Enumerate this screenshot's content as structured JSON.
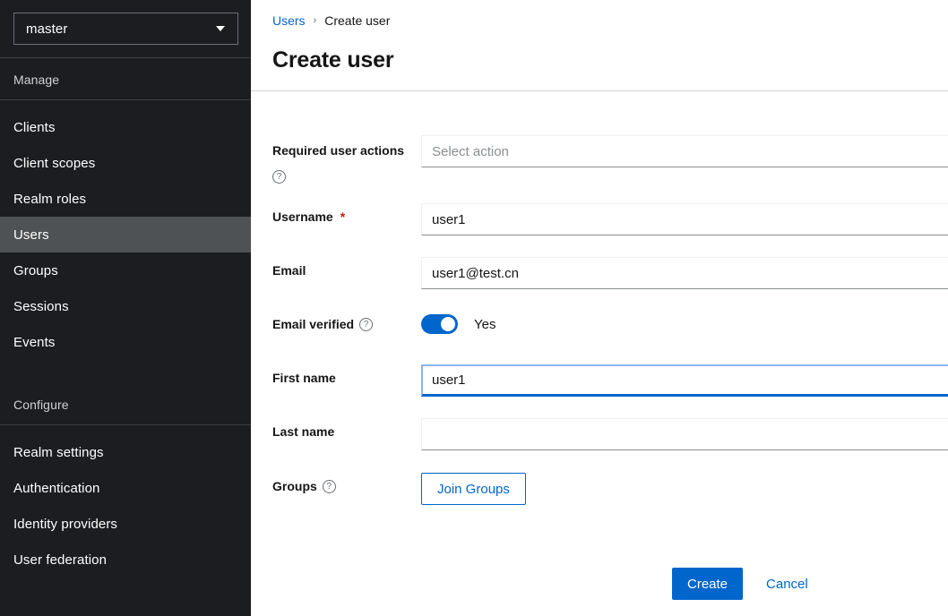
{
  "sidebar": {
    "realm_selector": {
      "value": "master",
      "icon": "chevron-down-icon"
    },
    "sections": [
      {
        "title": "Manage",
        "items": [
          {
            "label": "Clients",
            "selected": false
          },
          {
            "label": "Client scopes",
            "selected": false
          },
          {
            "label": "Realm roles",
            "selected": false
          },
          {
            "label": "Users",
            "selected": true
          },
          {
            "label": "Groups",
            "selected": false
          },
          {
            "label": "Sessions",
            "selected": false
          },
          {
            "label": "Events",
            "selected": false
          }
        ]
      },
      {
        "title": "Configure",
        "items": [
          {
            "label": "Realm settings",
            "selected": false
          },
          {
            "label": "Authentication",
            "selected": false
          },
          {
            "label": "Identity providers",
            "selected": false
          },
          {
            "label": "User federation",
            "selected": false
          }
        ]
      }
    ]
  },
  "header": {
    "breadcrumb": {
      "parent": "Users",
      "separator": "›",
      "current": "Create user"
    },
    "title": "Create user"
  },
  "form": {
    "required_user_actions": {
      "label": "Required user actions",
      "help_icon": "question-circle-icon",
      "placeholder": "Select action",
      "value": ""
    },
    "username": {
      "label": "Username",
      "required_marker": "*",
      "value": "user1",
      "placeholder": ""
    },
    "email": {
      "label": "Email",
      "value": "user1@test.cn",
      "placeholder": ""
    },
    "email_verified": {
      "label": "Email verified",
      "help_icon": "question-circle-icon",
      "state": "Yes",
      "on": true
    },
    "first_name": {
      "label": "First name",
      "value": "user1",
      "placeholder": "",
      "focused": true
    },
    "last_name": {
      "label": "Last name",
      "value": "",
      "placeholder": ""
    },
    "groups": {
      "label": "Groups",
      "help_icon": "question-circle-icon",
      "join_button": "Join Groups"
    },
    "actions": {
      "submit": "Create",
      "cancel": "Cancel"
    }
  },
  "colors": {
    "accent_blue": "#0066cc",
    "sidebar_bg": "#1b1d21",
    "sidebar_selected": "#4f5255",
    "required_red": "#c9190b",
    "focus_ring": "#8bb4f0"
  }
}
